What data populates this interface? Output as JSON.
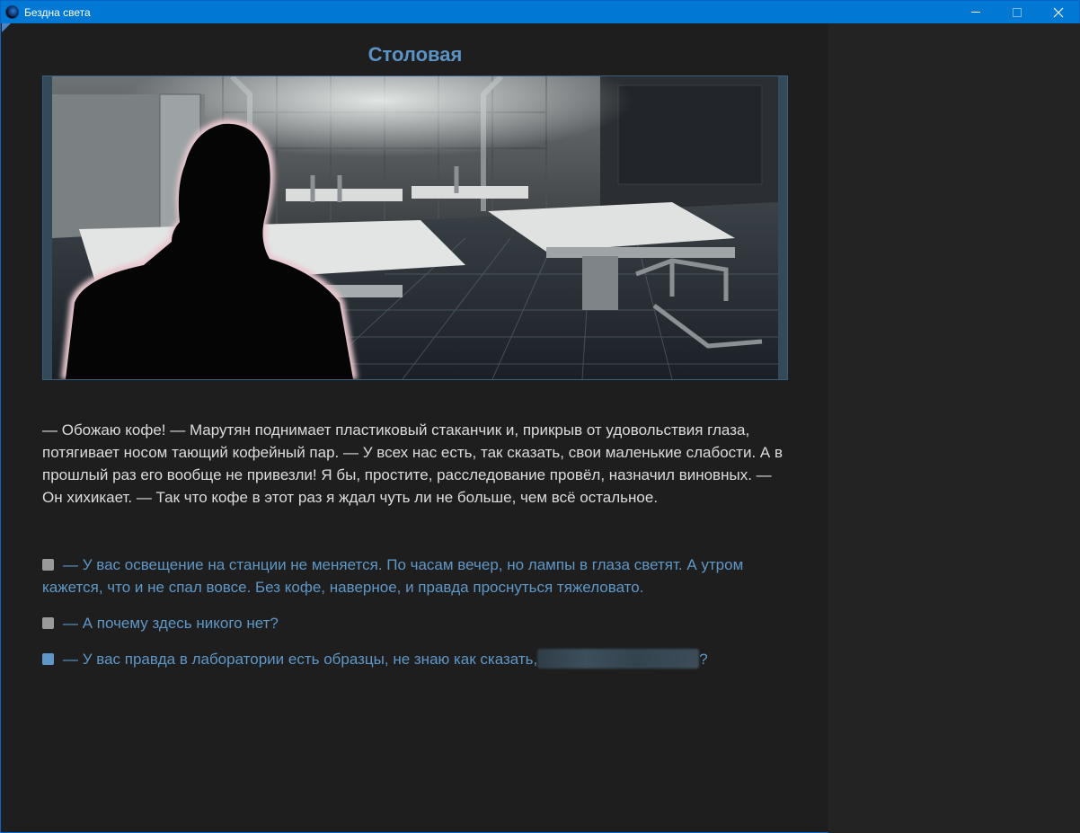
{
  "window": {
    "title": "Бездна света",
    "icon": "planet-app-icon"
  },
  "scene": {
    "title": "Столовая",
    "image": "cafeteria-scene-with-silhouette"
  },
  "narration": "— Обожаю кофе! — Марутян поднимает пластиковый стаканчик и, прикрыв от удовольствия глаза, потягивает носом тающий кофейный пар. — У всех нас есть, так сказать, свои маленькие слабости. А в прошлый раз его вообще не привезли! Я бы, простите, расследование провёл, назначил виновных. — Он хихикает. — Так что кофе в этот раз я ждал чуть ли не больше, чем всё остальное.",
  "choices": [
    {
      "text": "— У вас освещение на станции не меняется. По часам вечер, но лампы в глаза светят. А утром кажется, что и не спал вовсе. Без кофе, наверное, и правда проснуться тяжеловато.",
      "visited": true
    },
    {
      "text": "— А почему здесь никого нет?",
      "visited": true
    },
    {
      "text": "— У вас правда в лаборатории есть образцы, не знаю как сказать,",
      "suffix": "?",
      "visited": false
    }
  ],
  "colors": {
    "accent": "#5f97c6",
    "title": "#5b93c4",
    "text": "#dcdcdc",
    "background": "#1e1e1e",
    "titlebar": "#0078d4"
  }
}
